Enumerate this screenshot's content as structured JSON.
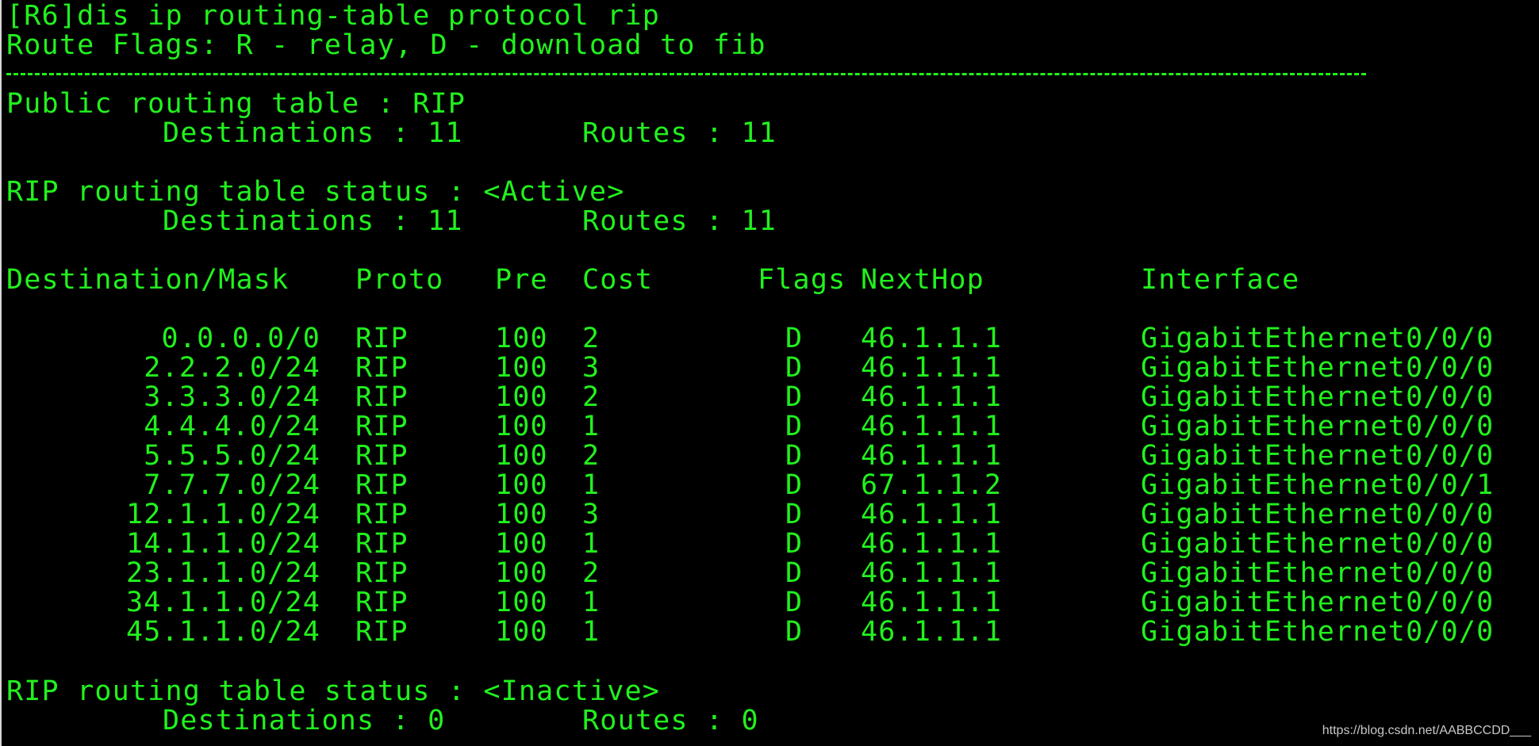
{
  "terminal": {
    "command_line": "[R6]dis ip routing-table protocol rip",
    "flags_legend": "Route Flags: R - relay, D - download to fib",
    "public_table": {
      "title": "Public routing table : RIP",
      "destinations": "Destinations : 11",
      "routes": "Routes : 11"
    },
    "active_status": {
      "title": "RIP routing table status : <Active>",
      "destinations": "Destinations : 11",
      "routes": "Routes : 11"
    },
    "headers": {
      "destination": "Destination/Mask",
      "proto": "Proto",
      "pre": "Pre",
      "cost": "Cost",
      "flags": "Flags",
      "nexthop": "NextHop",
      "interface": "Interface"
    },
    "routes": [
      {
        "dest": "0.0.0.0/0",
        "proto": "RIP",
        "pre": "100",
        "cost": "2",
        "flags": "D",
        "nexthop": "46.1.1.1",
        "interface": "GigabitEthernet0/0/0"
      },
      {
        "dest": "2.2.2.0/24",
        "proto": "RIP",
        "pre": "100",
        "cost": "3",
        "flags": "D",
        "nexthop": "46.1.1.1",
        "interface": "GigabitEthernet0/0/0"
      },
      {
        "dest": "3.3.3.0/24",
        "proto": "RIP",
        "pre": "100",
        "cost": "2",
        "flags": "D",
        "nexthop": "46.1.1.1",
        "interface": "GigabitEthernet0/0/0"
      },
      {
        "dest": "4.4.4.0/24",
        "proto": "RIP",
        "pre": "100",
        "cost": "1",
        "flags": "D",
        "nexthop": "46.1.1.1",
        "interface": "GigabitEthernet0/0/0"
      },
      {
        "dest": "5.5.5.0/24",
        "proto": "RIP",
        "pre": "100",
        "cost": "2",
        "flags": "D",
        "nexthop": "46.1.1.1",
        "interface": "GigabitEthernet0/0/0"
      },
      {
        "dest": "7.7.7.0/24",
        "proto": "RIP",
        "pre": "100",
        "cost": "1",
        "flags": "D",
        "nexthop": "67.1.1.2",
        "interface": "GigabitEthernet0/0/1"
      },
      {
        "dest": "12.1.1.0/24",
        "proto": "RIP",
        "pre": "100",
        "cost": "3",
        "flags": "D",
        "nexthop": "46.1.1.1",
        "interface": "GigabitEthernet0/0/0"
      },
      {
        "dest": "14.1.1.0/24",
        "proto": "RIP",
        "pre": "100",
        "cost": "1",
        "flags": "D",
        "nexthop": "46.1.1.1",
        "interface": "GigabitEthernet0/0/0"
      },
      {
        "dest": "23.1.1.0/24",
        "proto": "RIP",
        "pre": "100",
        "cost": "2",
        "flags": "D",
        "nexthop": "46.1.1.1",
        "interface": "GigabitEthernet0/0/0"
      },
      {
        "dest": "34.1.1.0/24",
        "proto": "RIP",
        "pre": "100",
        "cost": "1",
        "flags": "D",
        "nexthop": "46.1.1.1",
        "interface": "GigabitEthernet0/0/0"
      },
      {
        "dest": "45.1.1.0/24",
        "proto": "RIP",
        "pre": "100",
        "cost": "1",
        "flags": "D",
        "nexthop": "46.1.1.1",
        "interface": "GigabitEthernet0/0/0"
      }
    ],
    "inactive_status": {
      "title": "RIP routing table status : <Inactive>",
      "destinations": "Destinations : 0",
      "routes": "Routes : 0"
    }
  },
  "watermark": "https://blog.csdn.net/AABBCCDD___",
  "colors": {
    "background": "#000000",
    "text": "#21f21d",
    "watermark": "#c8c8c8"
  }
}
